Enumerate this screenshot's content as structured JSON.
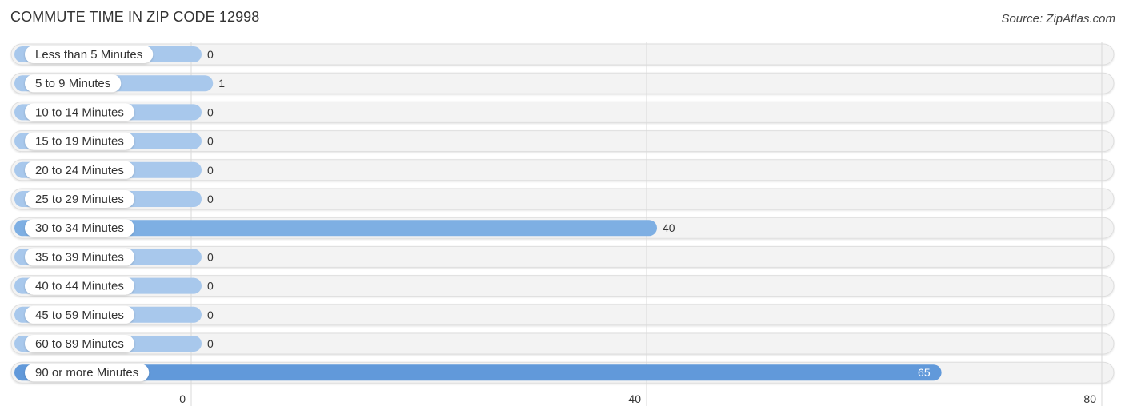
{
  "header": {
    "title": "COMMUTE TIME IN ZIP CODE 12998",
    "source": "Source: ZipAtlas.com"
  },
  "chart_data": {
    "type": "bar",
    "orientation": "horizontal",
    "title": "COMMUTE TIME IN ZIP CODE 12998",
    "xlabel": "",
    "ylabel": "",
    "xlim": [
      0,
      80
    ],
    "xticks": [
      0,
      40,
      80
    ],
    "grid": true,
    "categories": [
      "Less than 5 Minutes",
      "5 to 9 Minutes",
      "10 to 14 Minutes",
      "15 to 19 Minutes",
      "20 to 24 Minutes",
      "25 to 29 Minutes",
      "30 to 34 Minutes",
      "35 to 39 Minutes",
      "40 to 44 Minutes",
      "45 to 59 Minutes",
      "60 to 89 Minutes",
      "90 or more Minutes"
    ],
    "values": [
      0,
      1,
      0,
      0,
      0,
      0,
      40,
      0,
      0,
      0,
      0,
      65
    ],
    "colors": {
      "bar_light": "#a8c8ec",
      "bar_mid": "#7eafe3",
      "bar_strong": "#6199da",
      "track": "#f3f3f3",
      "track_border": "#dedede",
      "grid": "#d9d9d9",
      "text": "#333333",
      "value_inside": "#ffffff"
    }
  }
}
